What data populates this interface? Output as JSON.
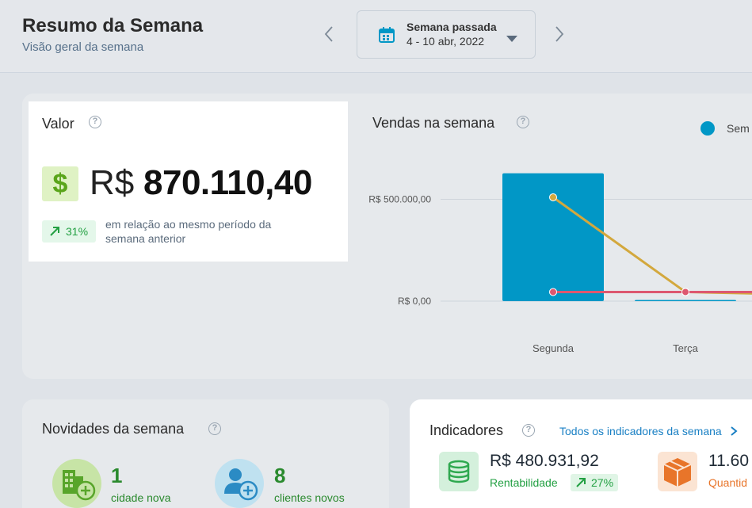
{
  "header": {
    "title": "Resumo da Semana",
    "subtitle": "Visão geral da semana",
    "week_selector": {
      "line1": "Semana passada",
      "line2": "4 - 10 abr, 2022"
    }
  },
  "valor": {
    "label": "Valor",
    "currency": "R$",
    "amount": "870.110,40",
    "change_pct": "31%",
    "change_text": "em relação ao mesmo período da semana anterior"
  },
  "chart": {
    "title": "Vendas na semana",
    "legend_label": "Sem"
  },
  "chart_data": {
    "type": "bar",
    "categories": [
      "Segunda",
      "Terça"
    ],
    "y_tick_labels": [
      "R$ 500.000,00",
      "R$ 0,00"
    ],
    "y_ticks": [
      500000,
      0
    ],
    "ylim": [
      0,
      650000
    ],
    "series": [
      {
        "name": "Sem",
        "type": "bar",
        "values": [
          628000,
          6000
        ],
        "color": "#0197c6"
      },
      {
        "type": "line",
        "values": [
          510000,
          45000
        ],
        "color": "#d3a83d"
      },
      {
        "type": "line",
        "values": [
          45000,
          45000
        ],
        "color": "#dd5870"
      }
    ]
  },
  "news": {
    "title": "Novidades da semana",
    "items": [
      {
        "count": "1",
        "label": "cidade nova"
      },
      {
        "count": "8",
        "label": "clientes novos"
      }
    ]
  },
  "indicators": {
    "title": "Indicadores",
    "link": "Todos os indicadores da semana",
    "items": [
      {
        "value": "R$ 480.931,92",
        "label": "Rentabilidade",
        "pct": "27%"
      },
      {
        "value": "11.60",
        "label": "Quantid"
      }
    ]
  },
  "colors": {
    "accent_blue": "#0197c6",
    "positive_green": "#23a043",
    "orange": "#e8752a"
  }
}
